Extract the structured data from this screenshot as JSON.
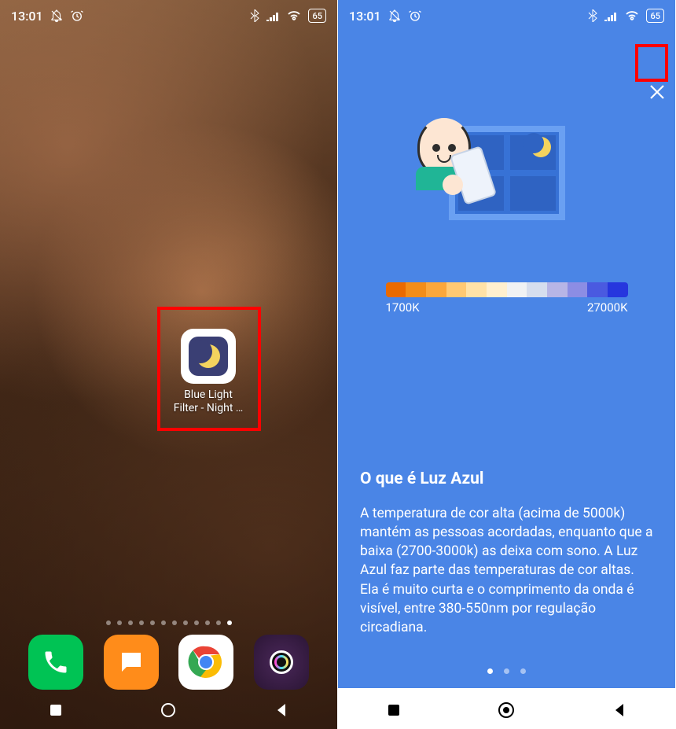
{
  "status_bar": {
    "time": "13:01",
    "battery": "65"
  },
  "home": {
    "app_label_line1": "Blue Light",
    "app_label_line2": "Filter - Night …",
    "page_count": 12,
    "active_page_index": 11
  },
  "onboard": {
    "scale_min": "1700K",
    "scale_max": "27000K",
    "title": "O que é Luz Azul",
    "body": "A temperatura de cor alta (acima de 5000k) mantém as pessoas acordadas, enquanto que a baixa (2700-3000k) as deixa com sono. A Luz Azul faz parte das temperaturas de cor altas. Ela é muito curta e o comprimento da onda é visível, entre 380-550nm por regulação circadiana.",
    "page_count": 3,
    "active_page_index": 0,
    "scale_colors": [
      "#ea6a00",
      "#f38d18",
      "#fba73b",
      "#ffc973",
      "#ffe2a7",
      "#fff0cf",
      "#f0f2f4",
      "#d6deee",
      "#b7b5e6",
      "#8c8de4",
      "#4a5ae0",
      "#2636de"
    ]
  }
}
